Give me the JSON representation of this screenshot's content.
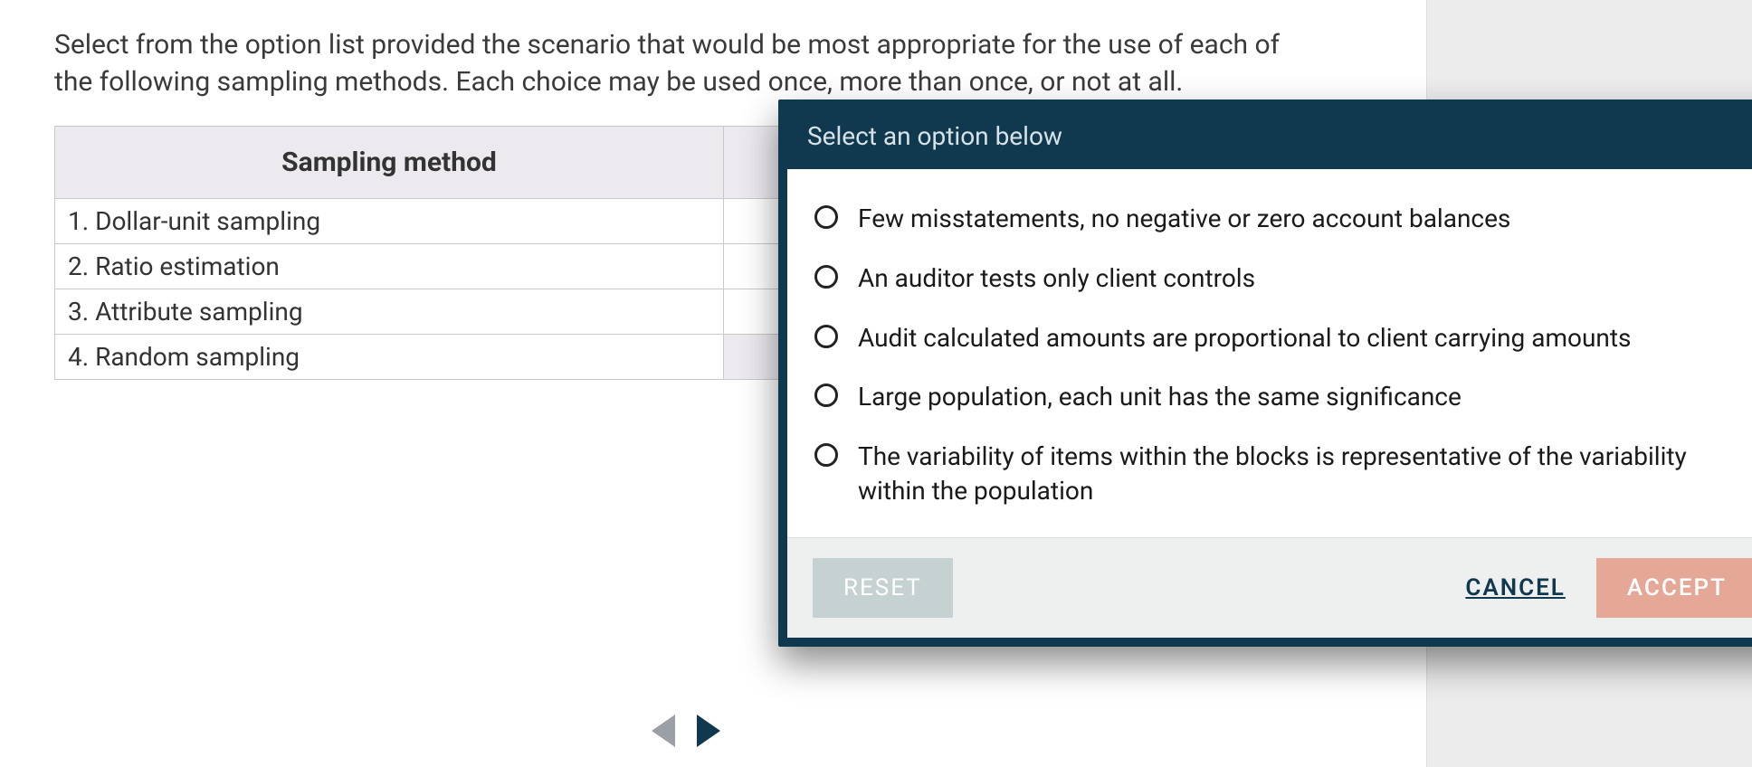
{
  "instructions": "Select from the option list provided the scenario that would be most appropriate for the use of each of the following sampling methods. Each choice may be used once, more than once, or not at all.",
  "table": {
    "header": "Sampling method",
    "rows": [
      "1. Dollar-unit sampling",
      "2. Ratio estimation",
      "3. Attribute sampling",
      "4. Random sampling"
    ]
  },
  "modal": {
    "title": "Select an option below",
    "options": [
      "Few misstatements, no negative or zero account balances",
      "An auditor tests only client controls",
      "Audit calculated amounts are proportional to client carrying amounts",
      "Large population, each unit has the same significance",
      "The variability of items within the blocks is representative of the variability within the population"
    ],
    "buttons": {
      "reset": "RESET",
      "cancel": "CANCEL",
      "accept": "ACCEPT"
    }
  }
}
